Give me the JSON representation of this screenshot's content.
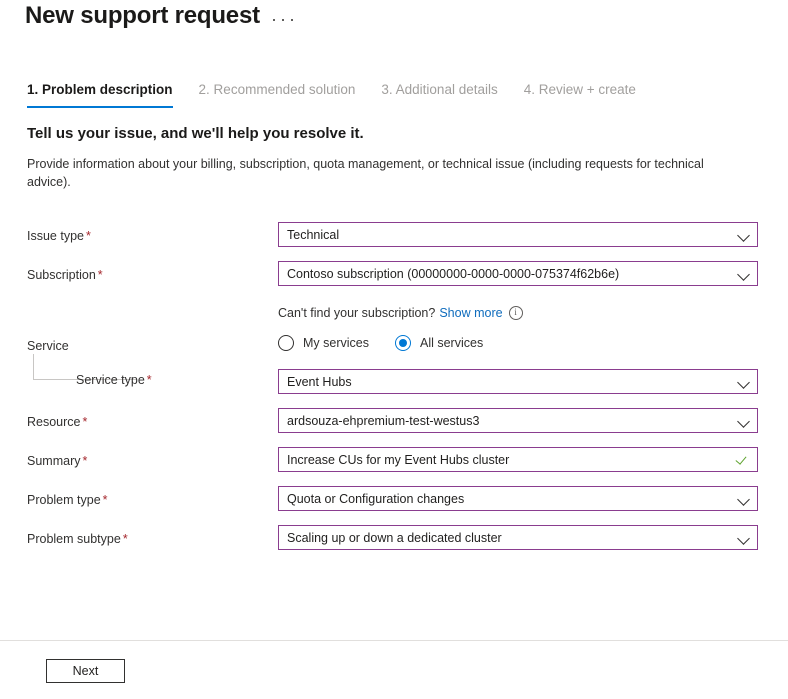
{
  "header": {
    "title": "New support request",
    "more_menu": "…"
  },
  "tabs": [
    {
      "label": "1. Problem description",
      "active": true
    },
    {
      "label": "2. Recommended solution",
      "active": false
    },
    {
      "label": "3. Additional details",
      "active": false
    },
    {
      "label": "4. Review + create",
      "active": false
    }
  ],
  "intro": {
    "heading": "Tell us your issue, and we'll help you resolve it.",
    "description": "Provide information about your billing, subscription, quota management, or technical issue (including requests for technical advice)."
  },
  "fields": {
    "issue_type": {
      "label": "Issue type",
      "required": "*",
      "value": "Technical",
      "control": "dropdown"
    },
    "subscription": {
      "label": "Subscription",
      "required": "*",
      "value": "Contoso subscription (00000000-0000-0000-075374f62b6e)",
      "control": "dropdown"
    },
    "subscription_hint": {
      "text": "Can't find your subscription?",
      "link": "Show more",
      "info_icon": "info-icon"
    },
    "service": {
      "label": "Service",
      "options": [
        {
          "label": "My services",
          "selected": false
        },
        {
          "label": "All services",
          "selected": true
        }
      ]
    },
    "service_type": {
      "label": "Service type",
      "required": "*",
      "value": "Event Hubs",
      "control": "dropdown"
    },
    "resource": {
      "label": "Resource",
      "required": "*",
      "value": "ardsouza-ehpremium-test-westus3",
      "control": "dropdown"
    },
    "summary": {
      "label": "Summary",
      "required": "*",
      "value": "Increase CUs for my Event Hubs cluster",
      "control": "validated-text",
      "validation_icon": "checkmark-icon"
    },
    "problem_type": {
      "label": "Problem type",
      "required": "*",
      "value": "Quota or Configuration changes",
      "control": "dropdown"
    },
    "problem_subtype": {
      "label": "Problem subtype",
      "required": "*",
      "value": "Scaling up or down a dedicated cluster",
      "control": "dropdown"
    }
  },
  "footer": {
    "next_label": "Next"
  },
  "colors": {
    "accent_blue": "#0078d4",
    "link_blue": "#0f6cbd",
    "field_border": "#8a3d8f",
    "required_red": "#a4262c",
    "valid_green": "#5ea32e",
    "muted_text": "#a19f9d"
  }
}
